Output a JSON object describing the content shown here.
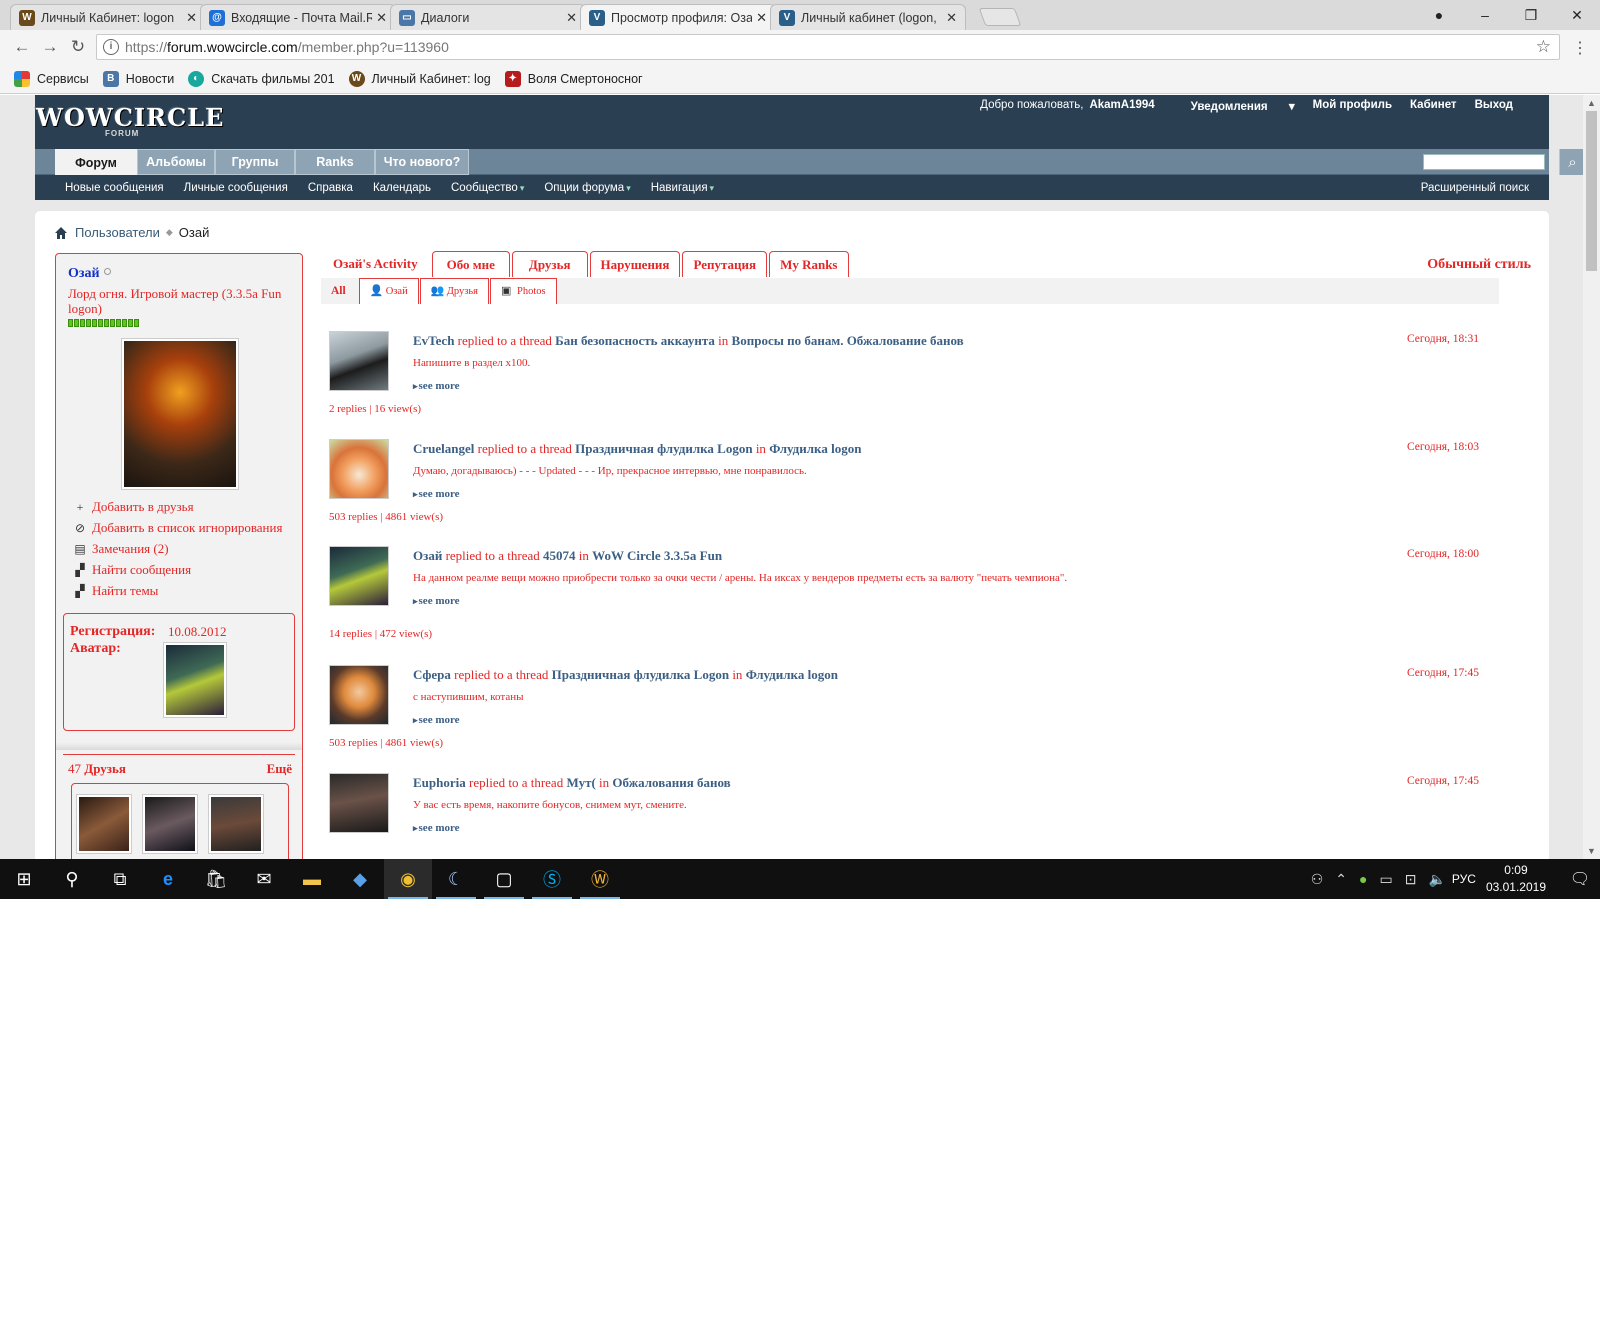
{
  "browser": {
    "tabs": [
      {
        "title": "Личный Кабинет: logon",
        "favicon": "wow-icon",
        "active": false
      },
      {
        "title": "Входящие - Почта Mail.R",
        "favicon": "mail-at-icon",
        "active": false
      },
      {
        "title": "Диалоги",
        "favicon": "vk-dialog-icon",
        "active": false
      },
      {
        "title": "Просмотр профиля: Озай",
        "favicon": "vbulletin-icon",
        "active": true
      },
      {
        "title": "Личный кабинет (logon,",
        "favicon": "vbulletin-icon",
        "active": false
      }
    ],
    "url": {
      "scheme": "https://",
      "host": "forum.wowcircle.com",
      "path": "/member.php?u=113960"
    },
    "bookmarks": [
      {
        "label": "Сервисы",
        "icon": "apps-grid-icon"
      },
      {
        "label": "Новости",
        "icon": "vk-icon"
      },
      {
        "label": "Скачать фильмы 201",
        "icon": "film-icon"
      },
      {
        "label": "Личный Кабинет: log",
        "icon": "wow-icon"
      },
      {
        "label": "Воля Смертоносног",
        "icon": "dragon-icon"
      }
    ]
  },
  "site": {
    "logo": "WOWCIRCLE",
    "logo_sub": "FORUM",
    "welcome": "Добро пожаловать,",
    "username": "AkamA1994",
    "notifications": "Уведомления",
    "my_profile": "Мой профиль",
    "cabinet": "Кабинет",
    "logout": "Выход",
    "nav_tabs": [
      "Форум",
      "Альбомы",
      "Группы",
      "Ranks",
      "Что нового?"
    ],
    "subnav": [
      "Новые сообщения",
      "Личные сообщения",
      "Справка",
      "Календарь",
      "Сообщество",
      "Опции форума",
      "Навигация"
    ],
    "advanced_search": "Расширенный поиск"
  },
  "breadcrumb": {
    "parent": "Пользователи",
    "current": "Озай"
  },
  "profile": {
    "name": "Озай",
    "title": "Лорд огня. Игровой мастер (3.3.5a Fun logon)",
    "reputation_pips": 12,
    "actions": [
      {
        "label": "Добавить в друзья",
        "icon": "plus-icon"
      },
      {
        "label": "Добавить в список игнорирования",
        "icon": "block-icon"
      },
      {
        "label": "Замечания (2)",
        "icon": "warning-doc-icon"
      },
      {
        "label": "Найти сообщения",
        "icon": "find-posts-icon"
      },
      {
        "label": "Найти темы",
        "icon": "find-threads-icon"
      }
    ],
    "reg_label": "Регистрация:",
    "reg_date": "10.08.2012",
    "avatar_label": "Аватар:",
    "friends_count": "47",
    "friends_label": "Друзья",
    "friends_more": "Ещё"
  },
  "profile_tabs": [
    "Озай's Activity",
    "Обо мне",
    "Друзья",
    "Нарушения",
    "Репутация",
    "My Ranks"
  ],
  "style_link": "Обычный стиль",
  "filters": [
    {
      "label": "All",
      "icon": ""
    },
    {
      "label": "Озай",
      "icon": "user-icon"
    },
    {
      "label": "Друзья",
      "icon": "users-icon"
    },
    {
      "label": "Photos",
      "icon": "photo-icon"
    }
  ],
  "activity": [
    {
      "user": "EvTech",
      "verb": "replied to a thread",
      "thread": "Бан безопасность аккаунта",
      "in_word": "in",
      "forum": "Вопросы по банам. Обжалование банов",
      "time": "Сегодня, 18:31",
      "excerpt": "Напишите в раздел x100.",
      "see_more": "see more",
      "stats": "2 replies | 16 view(s)"
    },
    {
      "user": "Cruelangel",
      "verb": "replied to a thread",
      "thread": "Праздничная флудилка Logon",
      "in_word": "in",
      "forum": "Флудилка logon",
      "time": "Сегодня, 18:03",
      "excerpt": "Думаю, догадываюсь) - - - Updated - - - Ир, прекрасное интервью, мне понравилось.",
      "see_more": "see more",
      "stats": "503 replies | 4861 view(s)"
    },
    {
      "user": "Озай",
      "verb": "replied to a thread",
      "thread": "45074",
      "in_word": "in",
      "forum": "WoW Circle 3.3.5a Fun",
      "time": "Сегодня, 18:00",
      "excerpt": "На данном реалме вещи можно приобрести только за очки чести / арены. На иксах у вендеров предметы есть за валюту \"печать чемпиона\".",
      "see_more": "see more",
      "stats": "14 replies | 472 view(s)"
    },
    {
      "user": "Сфера",
      "verb": "replied to a thread",
      "thread": "Праздничная флудилка Logon",
      "in_word": "in",
      "forum": "Флудилка logon",
      "time": "Сегодня, 17:45",
      "excerpt": "с наступившим, котаны",
      "see_more": "see more",
      "stats": "503 replies | 4861 view(s)"
    },
    {
      "user": "Euphoria",
      "verb": "replied to a thread",
      "thread": "Мут(",
      "in_word": "in",
      "forum": "Обжалования банов",
      "time": "Сегодня, 17:45",
      "excerpt": "У вас есть время, накопите бонусов, снимем мут, смените.",
      "see_more": "see more",
      "stats": ""
    }
  ],
  "taskbar": {
    "lang": "РУС",
    "time": "0:09",
    "date": "03.01.2019"
  }
}
